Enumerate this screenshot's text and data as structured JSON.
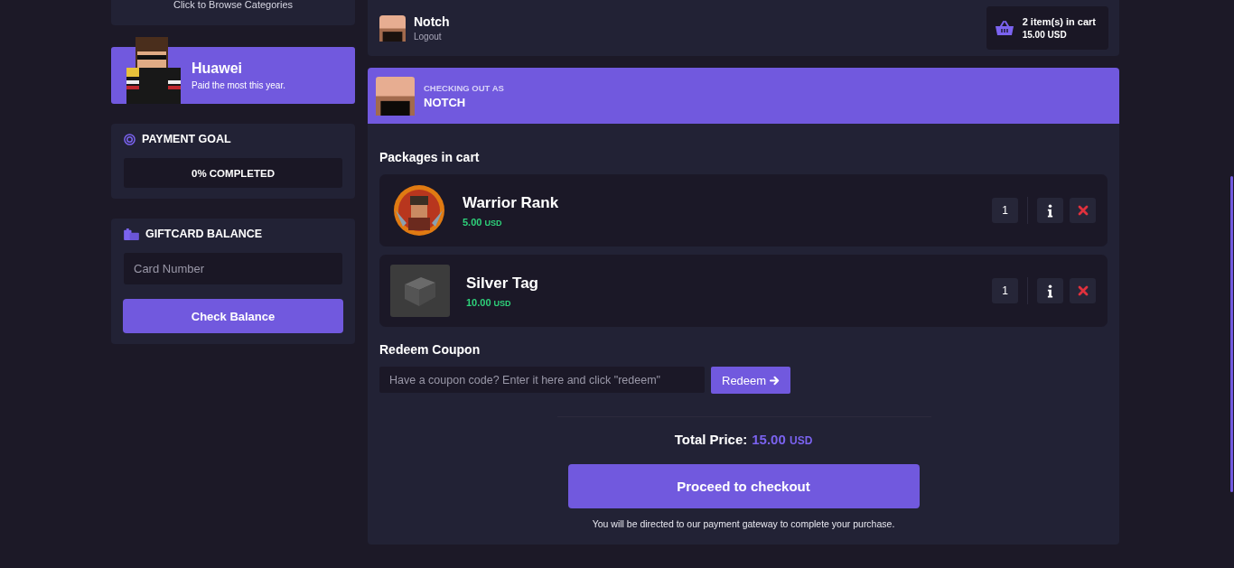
{
  "categories_card": {
    "text": "Click to Browse Categories"
  },
  "top_customer": {
    "name": "Huawei",
    "caption": "Paid the most this year."
  },
  "payment_goal": {
    "title": "PAYMENT GOAL",
    "level": 0,
    "progress_text": "0% COMPLETED"
  },
  "giftcard": {
    "title": "GIFTCARD BALANCE",
    "placeholder": "Card Number",
    "button": "Check Balance"
  },
  "user": {
    "name": "Notch",
    "logout": "Logout"
  },
  "cart_summary": {
    "count": "2 item(s) in cart",
    "total": "15.00 USD"
  },
  "checkout_banner": {
    "label": "CHECKING OUT AS",
    "name": "NOTCH"
  },
  "packages": {
    "title": "Packages in cart",
    "items": [
      {
        "kind": "round",
        "name": "Warrior Rank",
        "price": "5.00",
        "currency": "USD",
        "quantity": "1"
      },
      {
        "kind": "square",
        "name": "Silver Tag",
        "price": "10.00",
        "currency": "USD",
        "quantity": "1"
      }
    ]
  },
  "coupon": {
    "title": "Redeem Coupon",
    "placeholder": "Have a coupon code? Enter it here and click \"redeem\"",
    "button": "Redeem"
  },
  "total": {
    "label": "Total Price:",
    "amount": "15.00",
    "currency": "USD"
  },
  "checkout_button": "Proceed to checkout",
  "note": "You will be directed to our payment gateway to complete your purchase."
}
